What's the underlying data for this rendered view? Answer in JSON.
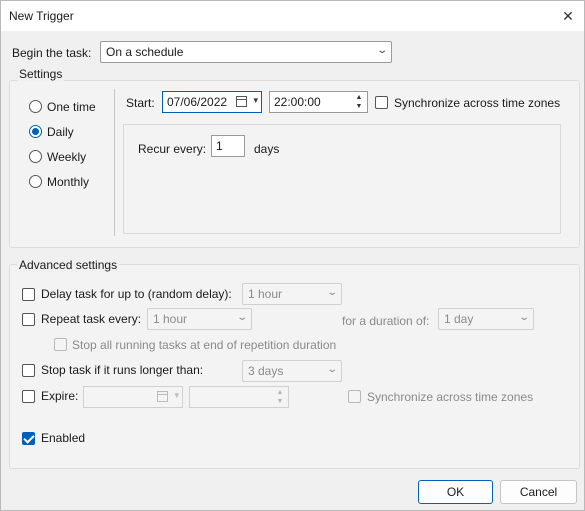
{
  "window": {
    "title": "New Trigger",
    "close_glyph": "✕"
  },
  "begin": {
    "label": "Begin the task:",
    "value": "On a schedule"
  },
  "settings": {
    "title": "Settings",
    "radios": [
      {
        "label": "One time",
        "selected": false
      },
      {
        "label": "Daily",
        "selected": true
      },
      {
        "label": "Weekly",
        "selected": false
      },
      {
        "label": "Monthly",
        "selected": false
      }
    ],
    "start_label": "Start:",
    "start_date": "07/06/2022",
    "start_time": "22:00:00",
    "sync_label": "Synchronize across time zones",
    "recur_label": "Recur every:",
    "recur_value": "1",
    "recur_unit": "days"
  },
  "advanced": {
    "title": "Advanced settings",
    "delay_label": "Delay task for up to (random delay):",
    "delay_value": "1 hour",
    "repeat_label": "Repeat task every:",
    "repeat_value": "1 hour",
    "duration_label": "for a duration of:",
    "duration_value": "1 day",
    "stop_running_label": "Stop all running tasks at end of repetition duration",
    "stop_longer_label": "Stop task if it runs longer than:",
    "stop_longer_value": "3 days",
    "expire_label": "Expire:",
    "expire_sync_label": "Synchronize across time zones",
    "enabled_label": "Enabled"
  },
  "buttons": {
    "ok": "OK",
    "cancel": "Cancel"
  },
  "colors": {
    "accent": "#005fb8"
  }
}
